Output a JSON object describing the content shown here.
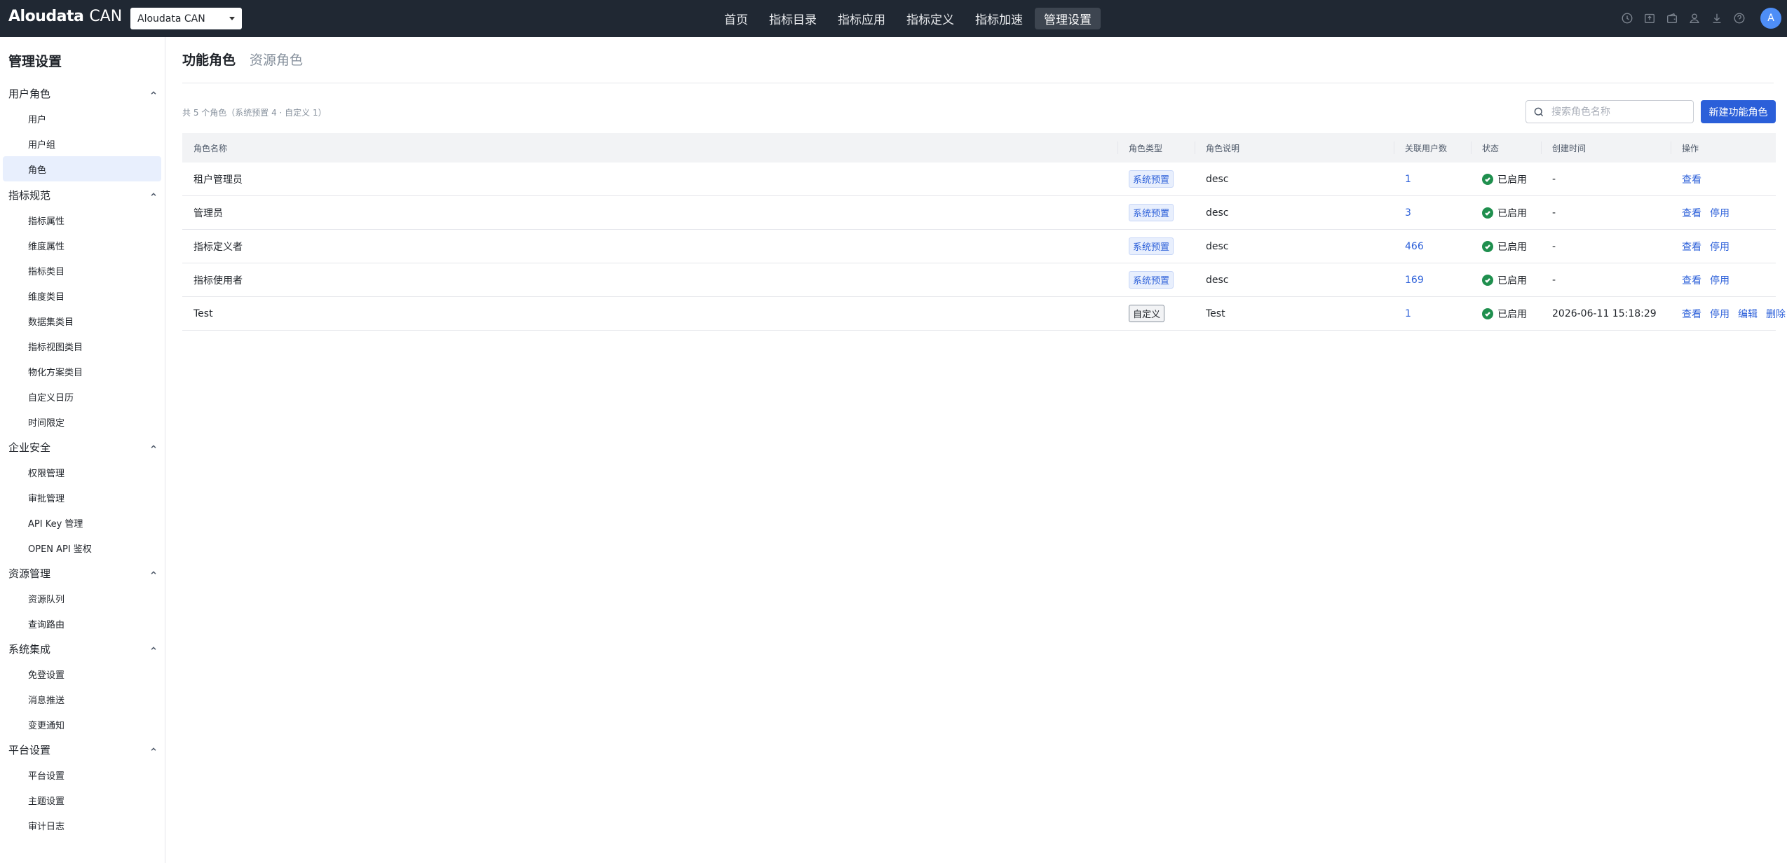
{
  "app": {
    "brand": "Aloudata",
    "suffix": "CAN",
    "tenant": "Aloudata CAN",
    "avatar_initial": "A"
  },
  "nav": {
    "items": [
      {
        "label": "首页"
      },
      {
        "label": "指标目录"
      },
      {
        "label": "指标应用"
      },
      {
        "label": "指标定义"
      },
      {
        "label": "指标加速"
      },
      {
        "label": "管理设置"
      }
    ],
    "active": "管理设置"
  },
  "top_icons": [
    "clock-icon",
    "export-icon",
    "wallet-icon",
    "user-share-icon",
    "download-icon",
    "help-icon"
  ],
  "sidebar": {
    "title": "管理设置",
    "groups": [
      {
        "label": "用户角色",
        "items": [
          "用户",
          "用户组",
          "角色"
        ]
      },
      {
        "label": "指标规范",
        "items": [
          "指标属性",
          "维度属性",
          "指标类目",
          "维度类目",
          "数据集类目",
          "指标视图类目",
          "物化方案类目",
          "自定义日历",
          "时间限定"
        ]
      },
      {
        "label": "企业安全",
        "items": [
          "权限管理",
          "审批管理",
          "API Key 管理",
          "OPEN API 鉴权"
        ]
      },
      {
        "label": "资源管理",
        "items": [
          "资源队列",
          "查询路由"
        ]
      },
      {
        "label": "系统集成",
        "items": [
          "免登设置",
          "消息推送",
          "变更通知"
        ]
      },
      {
        "label": "平台设置",
        "items": [
          "平台设置",
          "主题设置",
          "审计日志"
        ]
      }
    ],
    "selected": "角色"
  },
  "main": {
    "tabs": [
      {
        "label": "功能角色"
      },
      {
        "label": "资源角色"
      }
    ],
    "summary": "共 5 个角色（系统预置 4 · 自定义 1）",
    "search_placeholder": "搜索角色名称",
    "new_button": "新建功能角色"
  },
  "table": {
    "headers": [
      "角色名称",
      "角色类型",
      "角色说明",
      "关联用户数",
      "状态",
      "创建时间",
      "操作"
    ],
    "rows": [
      {
        "name": "租户管理员",
        "type": "系统预置",
        "desc": "desc",
        "users": "1",
        "status": "已启用",
        "created": "-",
        "actions": [
          "查看"
        ]
      },
      {
        "name": "管理员",
        "type": "系统预置",
        "desc": "desc",
        "users": "3",
        "status": "已启用",
        "created": "-",
        "actions": [
          "查看",
          "停用"
        ]
      },
      {
        "name": "指标定义者",
        "type": "系统预置",
        "desc": "desc",
        "users": "466",
        "status": "已启用",
        "created": "-",
        "actions": [
          "查看",
          "停用"
        ]
      },
      {
        "name": "指标使用者",
        "type": "系统预置",
        "desc": "desc",
        "users": "169",
        "status": "已启用",
        "created": "-",
        "actions": [
          "查看",
          "停用"
        ]
      },
      {
        "name": "Test",
        "type": "自定义",
        "desc": "Test",
        "users": "1",
        "status": "已启用",
        "created": "2026-06-11 15:18:29",
        "actions": [
          "查看",
          "停用",
          "编辑",
          "删除"
        ]
      }
    ]
  },
  "colors": {
    "topbar": "#202833",
    "accent": "#2b5fd9",
    "success": "#1f8f4e",
    "selected_bg": "#e8effd"
  }
}
